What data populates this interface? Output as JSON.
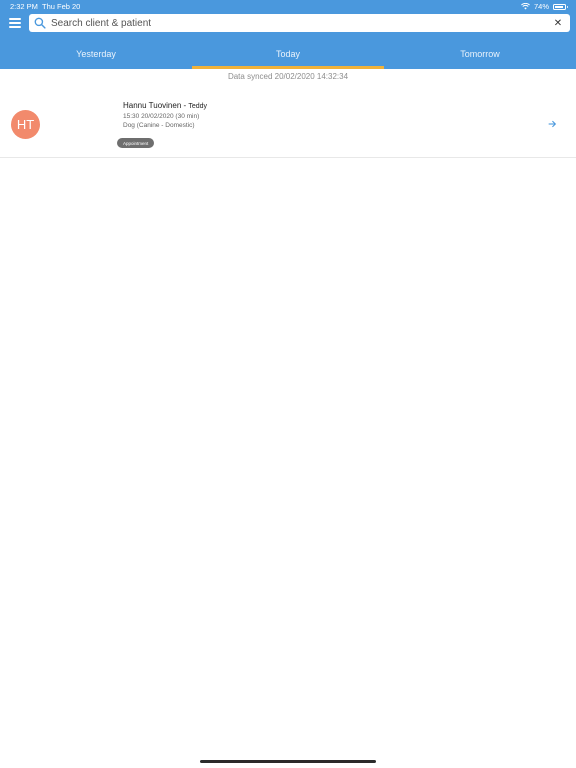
{
  "status_bar": {
    "time": "2:32 PM",
    "date": "Thu Feb 20",
    "battery": "74%"
  },
  "search": {
    "placeholder": "Search client & patient",
    "value": ""
  },
  "tabs": [
    {
      "label": "Yesterday",
      "active": false
    },
    {
      "label": "Today",
      "active": true
    },
    {
      "label": "Tomorrow",
      "active": false
    }
  ],
  "sync_text": "Data synced 20/02/2020 14:32:34",
  "appointments": [
    {
      "initials": "HT",
      "client": "Hannu Tuovinen",
      "separator": " - ",
      "patient": "Teddy",
      "time": "15:30 20/02/2020 (30 min)",
      "species": "Dog (Canine - Domestic)",
      "badge": "Appointment"
    }
  ],
  "colors": {
    "header": "#4a98dd",
    "tab_indicator": "#f0b23a",
    "avatar": "#f28a6c",
    "badge": "#6e6e6e"
  },
  "icons": {
    "menu": "hamburger-icon",
    "search": "search-icon",
    "clear": "close-icon",
    "row_action": "arrow-right-icon",
    "wifi": "wifi-icon",
    "battery": "battery-icon"
  }
}
